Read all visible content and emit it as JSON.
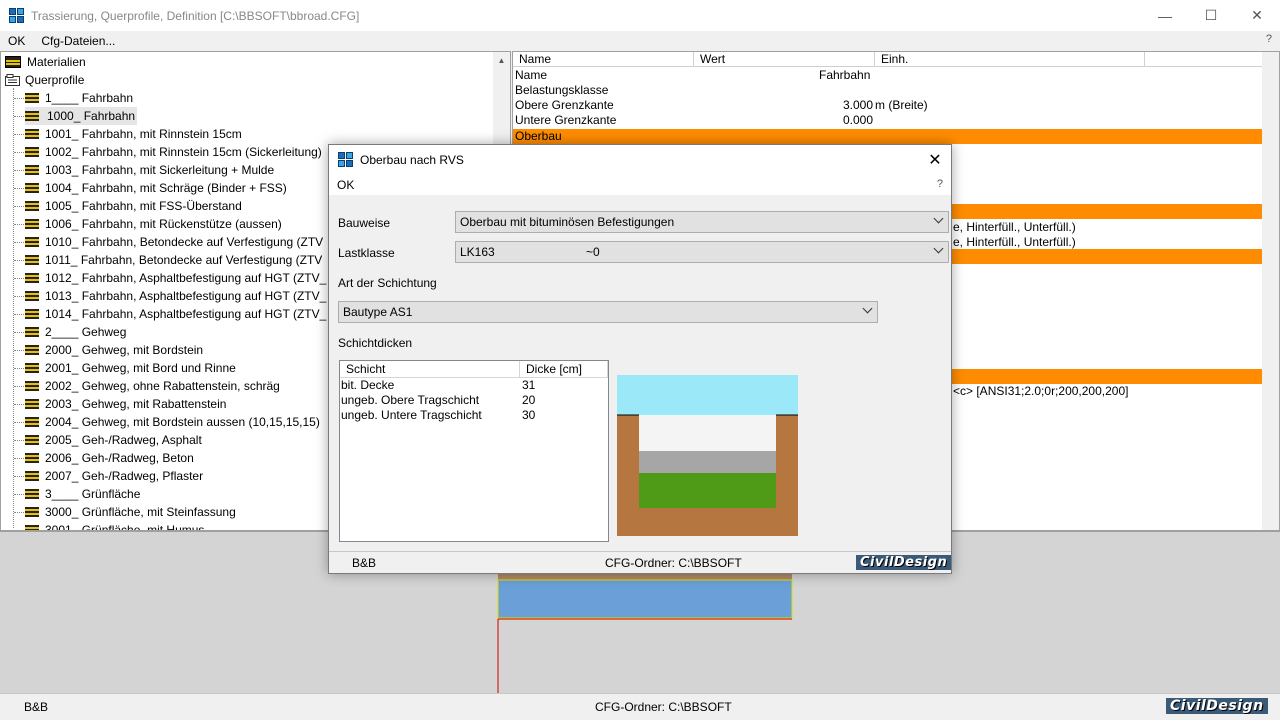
{
  "window": {
    "title": "Trassierung, Querprofile, Definition   [C:\\BBSOFT\\bbroad.CFG]",
    "minimize": "—",
    "maximize": "☐",
    "close": "✕"
  },
  "menu": {
    "ok": "OK",
    "cfg_files": "Cfg-Dateien...",
    "help": "?"
  },
  "tree": {
    "materials": "Materialien",
    "cross_sections": "Querprofile",
    "items": [
      "1____ Fahrbahn",
      "1000_ Fahrbahn",
      "1001_ Fahrbahn, mit Rinnstein 15cm",
      "1002_ Fahrbahn, mit Rinnstein 15cm (Sickerleitung)",
      "1003_ Fahrbahn, mit Sickerleitung + Mulde",
      "1004_ Fahrbahn, mit Schräge (Binder + FSS)",
      "1005_ Fahrbahn, mit FSS-Überstand",
      "1006_ Fahrbahn, mit Rückenstütze (aussen)",
      "1010_ Fahrbahn, Betondecke auf Verfestigung (ZTV",
      "1011_ Fahrbahn, Betondecke auf Verfestigung (ZTV",
      "1012_ Fahrbahn, Asphaltbefestigung auf HGT (ZTV_",
      "1013_ Fahrbahn, Asphaltbefestigung auf HGT (ZTV_",
      "1014_ Fahrbahn, Asphaltbefestigung auf HGT (ZTV_",
      "2____ Gehweg",
      "2000_ Gehweg, mit Bordstein",
      "2001_ Gehweg, mit Bord und Rinne",
      "2002_ Gehweg, ohne Rabattenstein, schräg",
      "2003_ Gehweg, mit Rabattenstein",
      "2004_ Gehweg, mit Bordstein aussen (10,15,15,15)",
      "2005_ Geh-/Radweg, Asphalt",
      "2006_ Geh-/Radweg, Beton",
      "2007_ Geh-/Radweg, Pflaster",
      "3____ Grünfläche",
      "3000_ Grünfläche, mit Steinfassung",
      "3001_ Grünfläche, mit Humus"
    ]
  },
  "grid": {
    "headers": [
      "Name",
      "Wert",
      "Einh."
    ],
    "rows": [
      {
        "name": "Name",
        "value": "Fahrbahn",
        "unit": ""
      },
      {
        "name": "Belastungsklasse",
        "value": "",
        "unit": ""
      },
      {
        "name": "Obere  Grenzkante",
        "value": "3.000",
        "unit": "m (Breite)"
      },
      {
        "name": "Untere Grenzkante",
        "value": "0.000",
        "unit": ""
      },
      {
        "name": "Oberbau",
        "value": "",
        "unit": ""
      }
    ],
    "fragments": [
      "e, Hinterfüll., Unterfüll.)",
      "e, Hinterfüll., Unterfüll.)",
      "<c> [ANSI31;2.0;0r;200,200,200]"
    ]
  },
  "status": {
    "left": "B&B",
    "folder": "CFG-Ordner:  C:\\BBSOFT",
    "logo": "CivilDesign"
  },
  "dialog": {
    "title": "Oberbau nach RVS",
    "close": "✕",
    "menu_ok": "OK",
    "menu_help": "?",
    "bauweise_label": "Bauweise",
    "bauweise_value": "Oberbau mit bituminösen Befestigungen",
    "lastklasse_label": "Lastklasse",
    "lastklasse_value": "LK163",
    "lastklasse_extra": "~0",
    "art_label": "Art der Schichtung",
    "art_value": "Bautype AS1",
    "schichtdicken_label": "Schichtdicken",
    "table": {
      "headers": [
        "Schicht",
        "Dicke [cm]"
      ],
      "rows": [
        {
          "layer": "bit. Decke",
          "thickness": "31"
        },
        {
          "layer": "ungeb. Obere Tragschicht",
          "thickness": "20"
        },
        {
          "layer": "ungeb. Untere Tragschicht",
          "thickness": "30"
        }
      ]
    },
    "status_left": "B&B",
    "status_folder": "CFG-Ordner:  C:\\BBSOFT",
    "logo": "CivilDesign"
  },
  "colors": {
    "accent_orange": "#ff8c00",
    "sky": "#9be8f8",
    "soil": "#b5773f",
    "decke": "#f4f4f4",
    "obere": "#a6a6a6",
    "untere": "#4f9a16",
    "preview_blue": "#6a9fd8"
  }
}
